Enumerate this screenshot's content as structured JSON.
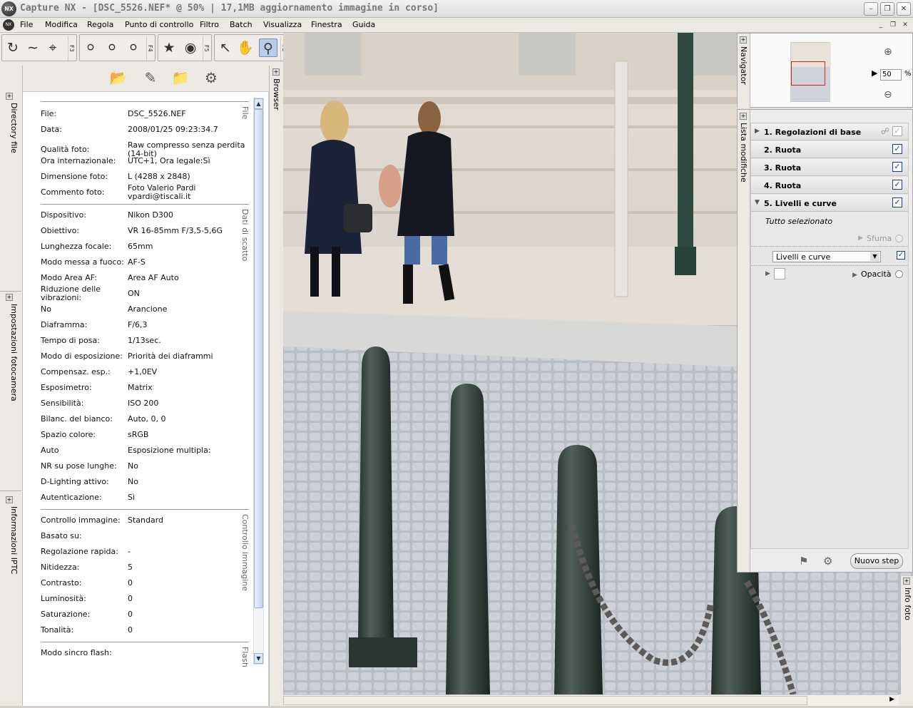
{
  "window": {
    "title": "Capture NX - [DSC_5526.NEF* @ 50% | 17,1MB aggiornamento immagine in corso]",
    "logo": "NX"
  },
  "menu": [
    "File",
    "Modifica",
    "Regola",
    "Punto di controllo",
    "Filtro",
    "Batch",
    "Visualizza",
    "Finestra",
    "Guida"
  ],
  "toolbar": {
    "fkeys": [
      "F3",
      "F4",
      "F5",
      "F2",
      "F6"
    ]
  },
  "side_tabs": [
    "Directory file",
    "Impostazioni fotocamera",
    "Informazioni IPTC"
  ],
  "browser_tab": "Browser",
  "info_sections": {
    "file_label": "File",
    "file": [
      {
        "k": "File:",
        "v": "DSC_5526.NEF"
      },
      {
        "k": "Data:",
        "v": "2008/01/25 09:23:34.7"
      },
      {
        "k": "Qualità foto:",
        "v": "Raw compresso senza perdita (14-bit)"
      },
      {
        "k": "Ora internazionale:",
        "v": "UTC+1, Ora legale:Sì"
      },
      {
        "k": "Dimensione foto:",
        "v": "L (4288 x 2848)"
      },
      {
        "k": "Commento foto:",
        "v": "Foto Valerio Pardi vpardi@tiscali.it"
      }
    ],
    "shot_label": "Dati di scatto",
    "shot": [
      {
        "k": "Dispositivo:",
        "v": "Nikon D300"
      },
      {
        "k": "Obiettivo:",
        "v": "VR 16-85mm F/3,5-5,6G"
      },
      {
        "k": "Lunghezza focale:",
        "v": "65mm"
      },
      {
        "k": "Modo messa a fuoco:",
        "v": "AF-S"
      },
      {
        "k": "Modo Area AF:",
        "v": "Area AF Auto"
      },
      {
        "k": "Riduzione delle vibrazioni:",
        "v": "ON"
      },
      {
        "k": "No",
        "v": "Arancione"
      },
      {
        "k": "Diaframma:",
        "v": "F/6,3"
      },
      {
        "k": "Tempo di posa:",
        "v": "1/13sec."
      },
      {
        "k": "Modo di esposizione:",
        "v": "Priorità dei diaframmi"
      },
      {
        "k": "Compensaz. esp.:",
        "v": "+1,0EV"
      },
      {
        "k": "Esposimetro:",
        "v": "Matrix"
      },
      {
        "k": "Sensibilità:",
        "v": "ISO 200"
      },
      {
        "k": "Bilanc. del bianco:",
        "v": "Auto, 0, 0"
      },
      {
        "k": "Spazio colore:",
        "v": "sRGB"
      },
      {
        "k": "Auto",
        "v": "Esposizione multipla:"
      },
      {
        "k": "NR su pose lunghe:",
        "v": "No"
      },
      {
        "k": "D-Lighting attivo:",
        "v": "No"
      },
      {
        "k": "Autenticazione:",
        "v": "Sì"
      }
    ],
    "control_label": "Controllo immagine",
    "control": [
      {
        "k": "Controllo immagine:",
        "v": "Standard"
      },
      {
        "k": "Basato su:",
        "v": ""
      },
      {
        "k": "Regolazione rapida:",
        "v": "-"
      },
      {
        "k": "Nitidezza:",
        "v": "5"
      },
      {
        "k": "Contrasto:",
        "v": "0"
      },
      {
        "k": "Luminosità:",
        "v": "0"
      },
      {
        "k": "Saturazione:",
        "v": "0"
      },
      {
        "k": "Tonalità:",
        "v": "0"
      }
    ],
    "flash_label": "Flash",
    "flash": [
      {
        "k": "Modo sincro flash:",
        "v": ""
      }
    ]
  },
  "navigator": {
    "tab": "Navigator",
    "zoom": "50",
    "percent": "%"
  },
  "edit_list": {
    "tab": "Lista modifiche",
    "steps": [
      {
        "label": "1. Regolazioni di base",
        "checked": false
      },
      {
        "label": "2. Ruota",
        "checked": true
      },
      {
        "label": "3. Ruota",
        "checked": true
      },
      {
        "label": "4. Ruota",
        "checked": true
      },
      {
        "label": "5. Livelli e curve",
        "checked": true
      }
    ],
    "selection": "Tutto selezionato",
    "sfuma": "Sfuma",
    "dropdown": "Livelli e curve",
    "opacita": "Opacità",
    "new_step": "Nuovo step"
  },
  "info_foto_tab": "Info foto"
}
